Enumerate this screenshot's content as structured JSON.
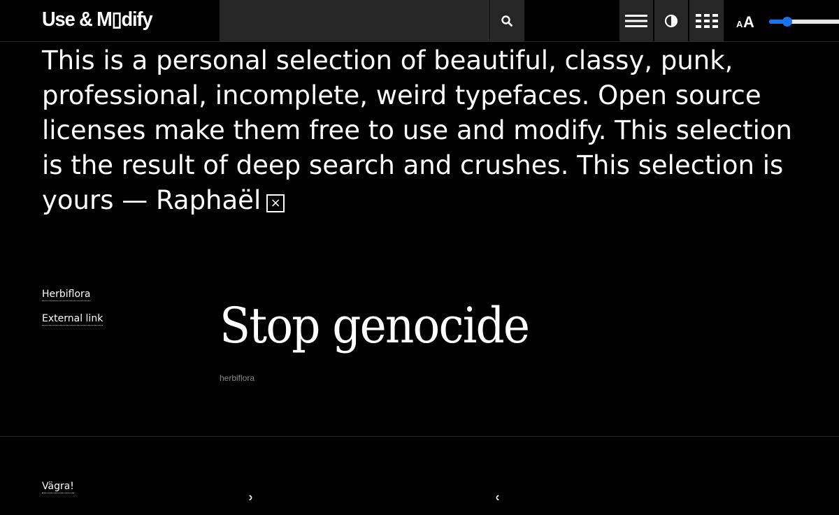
{
  "header": {
    "logo": "Use & M▯dify",
    "search": {
      "placeholder": "",
      "value": ""
    },
    "icons": {
      "search": "search-icon",
      "menu": "hamburger-menu-icon",
      "contrast": "contrast-icon",
      "grid": "grid-view-icon",
      "font_size": "font-size-icon"
    },
    "font_size_slider": {
      "value_fraction": 0.24,
      "accent_color": "#1a73e8"
    }
  },
  "intro": {
    "text": "This is a personal selection of beautiful, classy, punk, professional, incomplete, weird typefaces. Open source licenses make them free to use and modify. This selection is the result of deep search and crushes. This selection is yours — Raphaël",
    "close_label": "×"
  },
  "fonts": [
    {
      "name": "Herbiflora",
      "link_label": "External link",
      "specimen": "Stop genocide",
      "label": "herbiflora"
    },
    {
      "name": "Vägra!"
    }
  ],
  "colors": {
    "background": "#000000",
    "text": "#ffffff",
    "toolbar": "#262626",
    "muted": "#888888"
  }
}
